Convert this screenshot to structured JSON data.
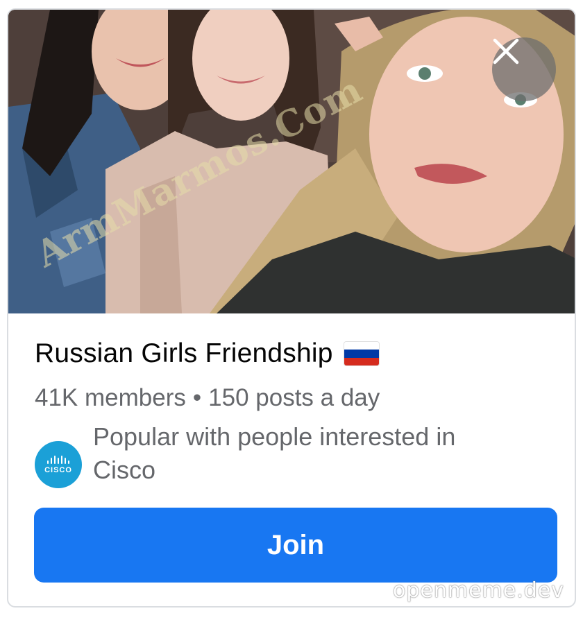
{
  "group": {
    "name": "Russian Girls Friendship",
    "flag_icon": "russia-flag-icon",
    "flag_colors": [
      "#ffffff",
      "#0039a6",
      "#d52b1e"
    ],
    "members": "41K members",
    "separator": "•",
    "posts": "150 posts a day"
  },
  "photo": {
    "watermark_text": "ArmMarmos.Com"
  },
  "interest": {
    "icon": "cisco-logo-icon",
    "logo_text": "CISCO",
    "text": "Popular with people interested in Cisco"
  },
  "actions": {
    "join_label": "Join",
    "close_icon": "close-icon"
  },
  "colors": {
    "accent": "#1877f2",
    "cisco": "#1ba0d7",
    "secondary_text": "#65676b"
  },
  "footer": {
    "watermark": "openmeme.dev"
  }
}
